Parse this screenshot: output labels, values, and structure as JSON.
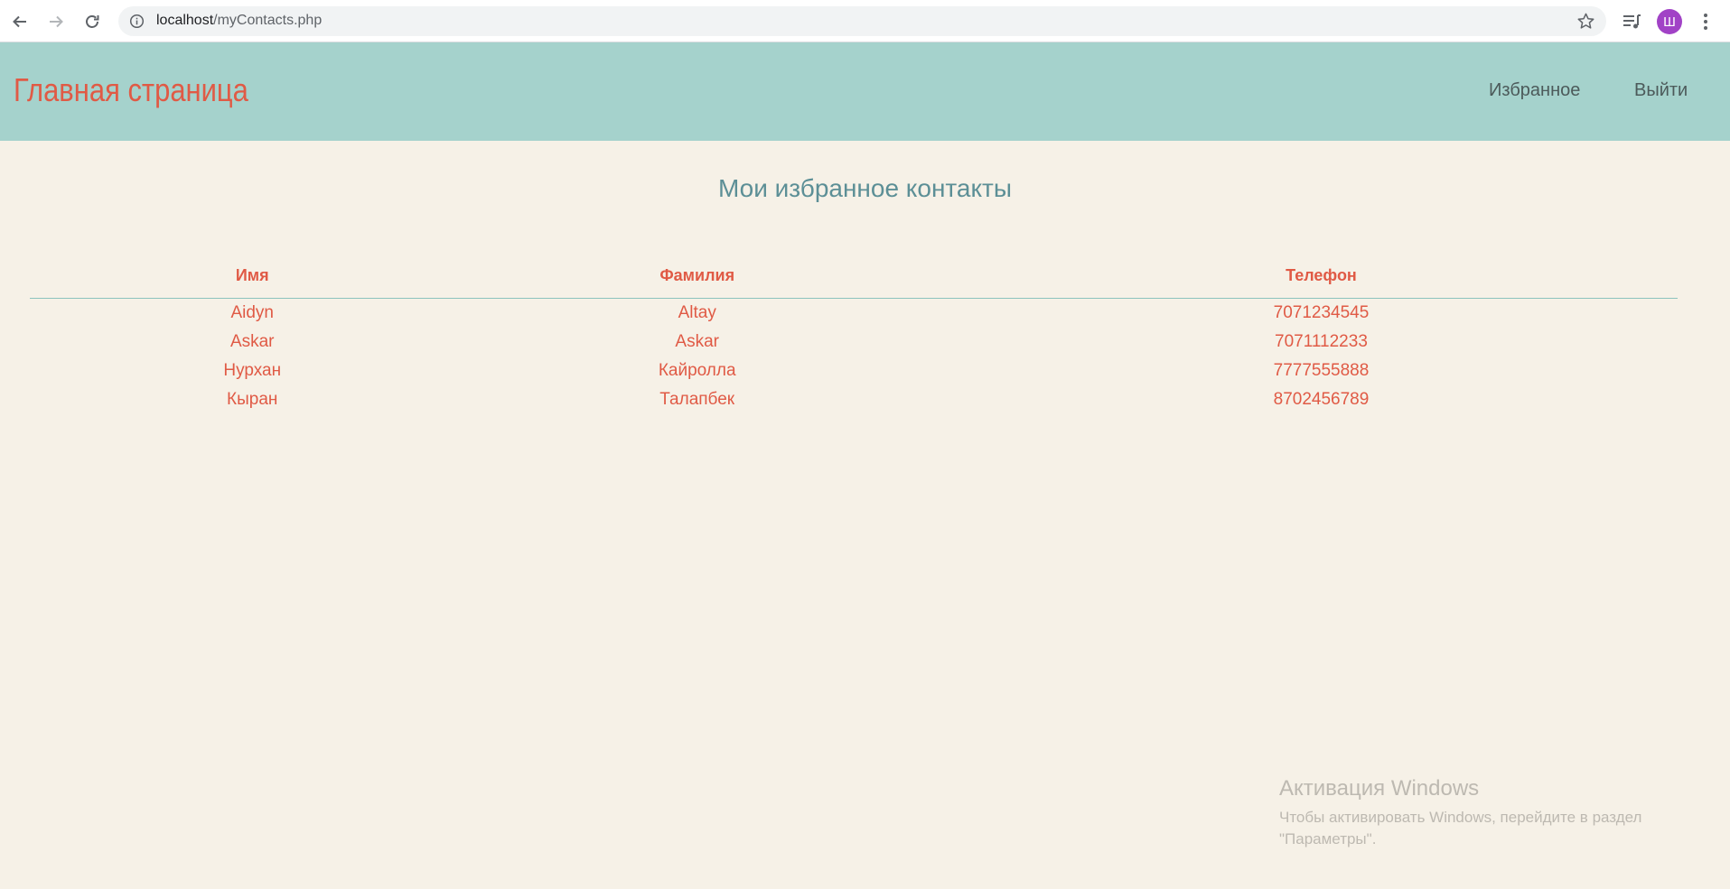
{
  "browser": {
    "url_host": "localhost",
    "url_path": "/myContacts.php",
    "profile_initial": "Ш"
  },
  "header": {
    "title": "Главная страница",
    "nav": [
      {
        "label": "Избранное"
      },
      {
        "label": "Выйти"
      }
    ],
    "background_color": "#a5d2cc",
    "title_color": "#e05a45"
  },
  "main": {
    "heading": "Мои избранное контакты",
    "table": {
      "headers": [
        "Имя",
        "Фамилия",
        "Телефон"
      ],
      "rows": [
        [
          "Aidyn",
          "Altay",
          "7071234545"
        ],
        [
          "Askar",
          "Askar",
          "7071112233"
        ],
        [
          "Нурхан",
          "Кайролла",
          "7777555888"
        ],
        [
          "Кыран",
          "Талапбек",
          "8702456789"
        ]
      ]
    }
  },
  "watermark": {
    "title": "Активация Windows",
    "text": "Чтобы активировать Windows, перейдите в раздел \"Параметры\"."
  }
}
